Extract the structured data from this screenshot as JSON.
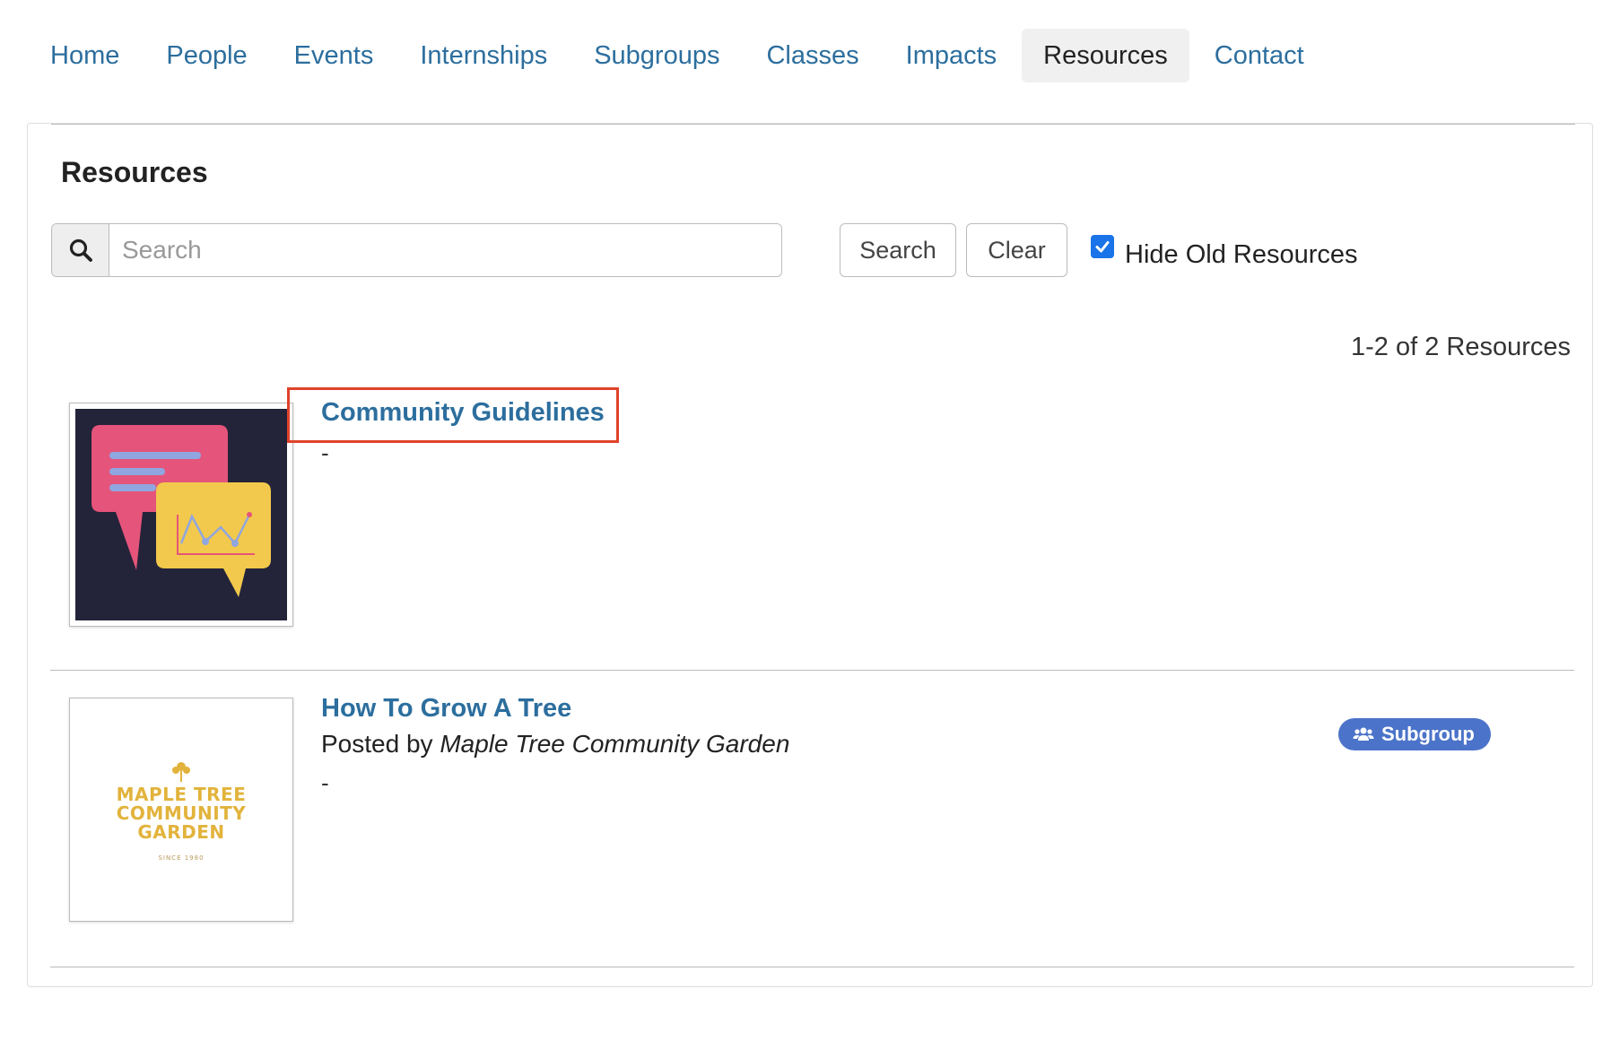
{
  "nav": {
    "items": [
      {
        "label": "Home",
        "active": false
      },
      {
        "label": "People",
        "active": false
      },
      {
        "label": "Events",
        "active": false
      },
      {
        "label": "Internships",
        "active": false
      },
      {
        "label": "Subgroups",
        "active": false
      },
      {
        "label": "Classes",
        "active": false
      },
      {
        "label": "Impacts",
        "active": false
      },
      {
        "label": "Resources",
        "active": true
      },
      {
        "label": "Contact",
        "active": false
      }
    ]
  },
  "panel": {
    "title": "Resources",
    "search": {
      "icon": "search-icon",
      "placeholder": "Search",
      "value": ""
    },
    "search_button": "Search",
    "clear_button": "Clear",
    "hide_old": {
      "label": "Hide Old Resources",
      "checked": true
    },
    "count_text": "1-2 of 2 Resources"
  },
  "resources": [
    {
      "title": "Community Guidelines",
      "description": "-",
      "thumbnail": "chat-bubbles-illustration"
    },
    {
      "title": "How To Grow A Tree",
      "posted_prefix": "Posted by",
      "posted_by": "Maple Tree Community Garden",
      "description": "-",
      "badge": "Subgroup",
      "badge_icon": "users-icon",
      "thumbnail": "maple-tree-logo",
      "logo": {
        "line1": "MAPLE TREE",
        "line2": "COMMUNITY",
        "line3": "GARDEN",
        "tagline": "SINCE 1980"
      }
    }
  ],
  "colors": {
    "link": "#2c6e9e",
    "badge": "#4b73c9",
    "checkbox": "#1a73e8",
    "highlight": "#e0422b",
    "logo_gold": "#e2b33c"
  }
}
